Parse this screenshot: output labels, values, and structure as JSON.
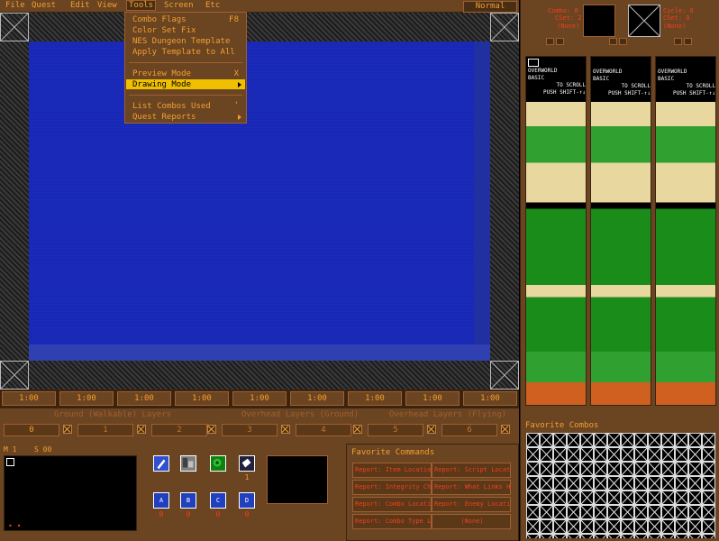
{
  "menubar": {
    "items": [
      "File",
      "Quest",
      "Edit",
      "View",
      "Tools",
      "Screen",
      "Etc"
    ],
    "mode": "Normal"
  },
  "tools_menu": {
    "items": [
      {
        "label": "Combo Flags",
        "key": "F8"
      },
      {
        "label": "Color Set Fix",
        "key": ""
      },
      {
        "label": "NES Dungeon Template",
        "key": ""
      },
      {
        "label": "Apply Template to All",
        "key": ""
      },
      {
        "label": "Preview Mode",
        "key": "X"
      },
      {
        "label": "Drawing Mode",
        "key": ""
      },
      {
        "label": "List Combos Used",
        "key": "'"
      },
      {
        "label": "Quest Reports",
        "key": ""
      }
    ]
  },
  "zoom_buttons": [
    "1:00",
    "1:00",
    "1:00",
    "1:00",
    "1:00",
    "1:00",
    "1:00",
    "1:00",
    "1:00"
  ],
  "layers": {
    "ground_header": "Ground (Walkable) Layers",
    "overhead_ground_header": "Overhead Layers (Ground)",
    "overhead_flying_header": "Overhead Layers (Flying)",
    "values": [
      "0",
      "1",
      "2",
      "3",
      "4",
      "5",
      "6"
    ]
  },
  "minimap": {
    "map_label": "M 1",
    "screen_label": "S 00",
    "marks": "• •"
  },
  "combo_slots": {
    "row1_labels": [
      "",
      "",
      "",
      "1"
    ],
    "row2_labels": [
      "A",
      "B",
      "C",
      "D"
    ],
    "values": [
      "0",
      "0",
      "0",
      "0"
    ]
  },
  "favorite_commands": {
    "title": "Favorite Commands",
    "buttons": [
      "Report: Item Locations",
      "Report: Script Locations",
      "Report: Integrity Check",
      "Report: What Links Here",
      "Report: Combo Locations",
      "Report: Enemy Locations",
      "Report: Combo Type Locs",
      "(None)"
    ]
  },
  "combo_info": {
    "left": {
      "combo": "Combo: 0",
      "cset": "CSet: 2",
      "extra": "(None)"
    },
    "right": {
      "cycle": "Cycle: 0",
      "cset": "CSet: 0",
      "extra": "(None)"
    }
  },
  "tile_banner": {
    "line1": "OVERWORLD",
    "line2": "BASIC",
    "line3": "TO SCROLL",
    "line4": "PUSH SHIFT-↑↓"
  },
  "favorite_combos": {
    "title": "Favorite Combos"
  },
  "colors": {
    "brown": "#6b4422",
    "orange": "#f0a030",
    "blue": "#1a2cc0",
    "highlight": "#f0c000"
  }
}
